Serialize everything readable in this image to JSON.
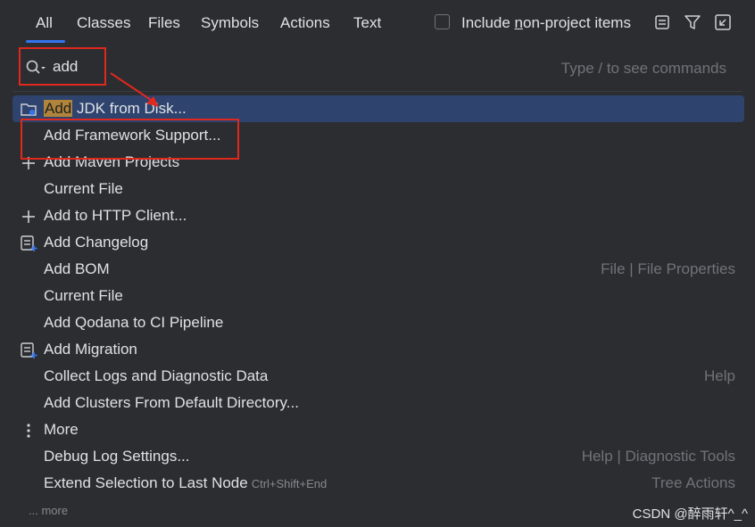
{
  "tabs": [
    "All",
    "Classes",
    "Files",
    "Symbols",
    "Actions",
    "Text"
  ],
  "filter": {
    "include_prefix": "Include ",
    "include_mnemonic": "n",
    "include_suffix": "on-project items"
  },
  "icons": {
    "preview": "preview-panel-icon",
    "filter": "filter-icon",
    "collapse": "collapse-icon"
  },
  "search": {
    "value": "add",
    "hint": "Type / to see commands"
  },
  "results": [
    {
      "highlight": "Add",
      "rest": " JDK from Disk...",
      "icon": "folder-jdk-icon",
      "hint": ""
    },
    {
      "label": "Add Framework Support...",
      "icon": "",
      "hint": ""
    },
    {
      "label": "Add Maven Projects",
      "icon": "plus-icon",
      "hint": ""
    },
    {
      "label": "Current File",
      "icon": "",
      "hint": ""
    },
    {
      "label": "Add to HTTP Client...",
      "icon": "plus-icon",
      "hint": ""
    },
    {
      "label": "Add Changelog",
      "icon": "changelog-add-icon",
      "hint": ""
    },
    {
      "label": "Add BOM",
      "icon": "",
      "hint": "File | File Properties"
    },
    {
      "label": "Current File",
      "icon": "",
      "hint": ""
    },
    {
      "label": "Add Qodana to CI Pipeline",
      "icon": "",
      "hint": ""
    },
    {
      "label": "Add Migration",
      "icon": "changelog-add-icon",
      "hint": ""
    },
    {
      "label": "Collect Logs and Diagnostic Data",
      "icon": "",
      "hint": "Help"
    },
    {
      "label": "Add Clusters From Default Directory...",
      "icon": "",
      "hint": ""
    },
    {
      "label": "More",
      "icon": "vertical-dots-icon",
      "hint": ""
    },
    {
      "label": "Debug Log Settings...",
      "icon": "",
      "hint": "Help | Diagnostic Tools"
    },
    {
      "label": "Extend Selection to Last Node",
      "shortcut": "Ctrl+Shift+End",
      "icon": "",
      "hint": "Tree Actions"
    }
  ],
  "footer": {
    "more": "... more"
  },
  "watermark": "CSDN @醉雨轩^_^",
  "colors": {
    "accent": "#3574f0",
    "selection": "#2e436e",
    "highlight": "#b0843a",
    "annotation": "#e0281e"
  }
}
